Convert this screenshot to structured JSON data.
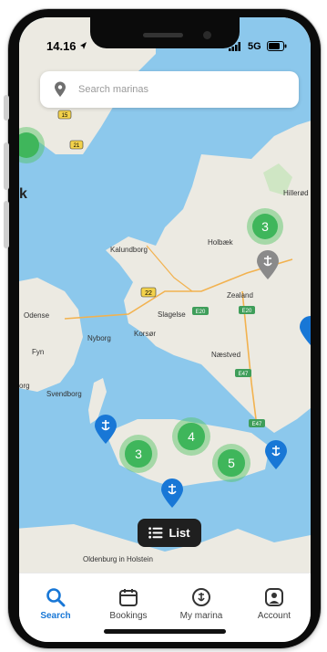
{
  "status_bar": {
    "time": "14.16",
    "network": "5G"
  },
  "search": {
    "placeholder": "Search marinas"
  },
  "map": {
    "place_labels": [
      "Kalundborg",
      "Holbæk",
      "Hillerød",
      "Zealand",
      "Slagelse",
      "Odense",
      "Nyborg",
      "Korsør",
      "Næstved",
      "Fyn",
      "Svendborg",
      "Oldenburg in Holstein",
      "k",
      "org"
    ],
    "road_labels": [
      "15",
      "21",
      "22",
      "E20",
      "E20",
      "E47",
      "E47"
    ],
    "clusters": [
      "3",
      "4",
      "3",
      "5"
    ],
    "marker_icon": "marina-marker-icon",
    "colors": {
      "water": "#8cc8ec",
      "land": "#eceae2",
      "cluster": "#3fb65b",
      "marker_blue": "#1877d6",
      "marker_gray": "#8a8a8a"
    }
  },
  "list_button": {
    "label": "List"
  },
  "tabs": [
    {
      "label": "Search",
      "icon": "search-icon",
      "active": true
    },
    {
      "label": "Bookings",
      "icon": "calendar-icon",
      "active": false
    },
    {
      "label": "My marina",
      "icon": "marina-icon",
      "active": false
    },
    {
      "label": "Account",
      "icon": "account-icon",
      "active": false
    }
  ],
  "accent_color": "#1877d6"
}
